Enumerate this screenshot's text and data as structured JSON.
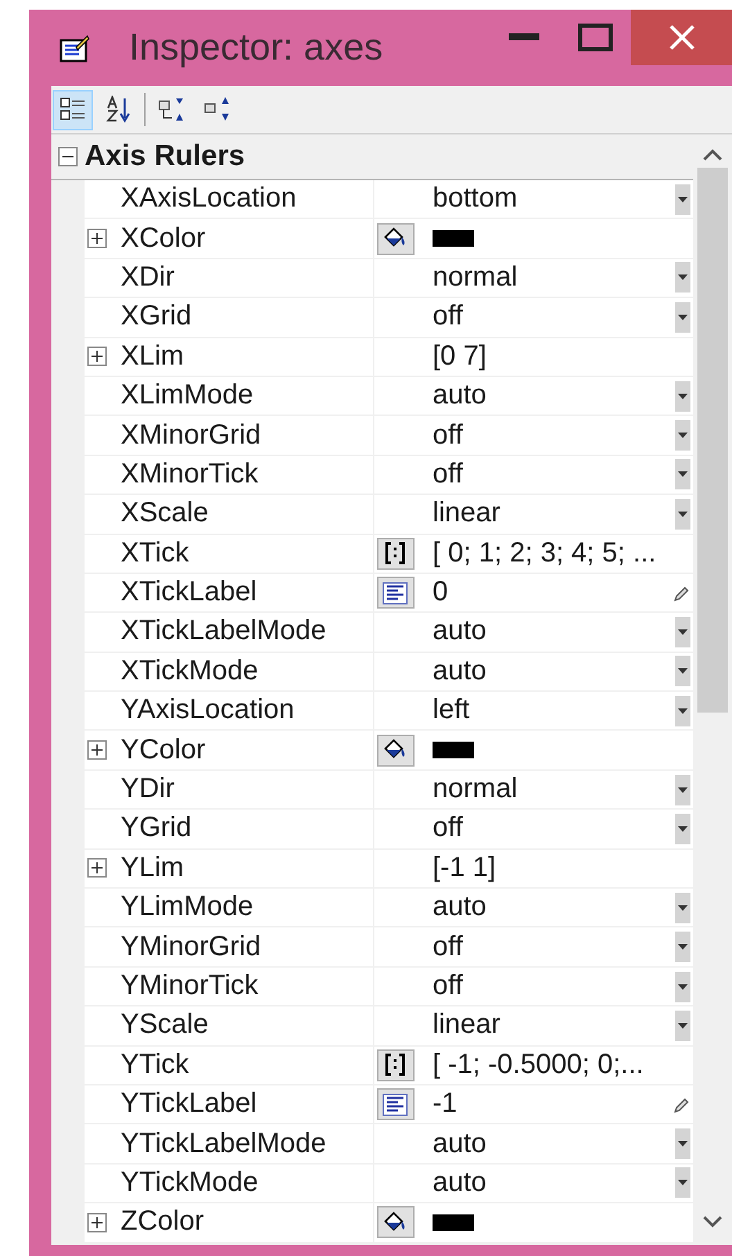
{
  "window": {
    "title": "Inspector:  axes"
  },
  "toolbar": [
    {
      "selected": true
    },
    {
      "selected": false
    },
    {
      "selected": false
    },
    {
      "selected": false
    }
  ],
  "category": {
    "label": "Axis Rulers",
    "expanded": true
  },
  "properties": [
    {
      "name": "XAxisLocation",
      "value": "bottom",
      "kind": "dropdown"
    },
    {
      "name": "XColor",
      "kind": "color",
      "expanded": false,
      "color": "#000000"
    },
    {
      "name": "XDir",
      "value": "normal",
      "kind": "dropdown"
    },
    {
      "name": "XGrid",
      "value": "off",
      "kind": "dropdown"
    },
    {
      "name": "XLim",
      "value": "[0 7]",
      "kind": "text",
      "expanded": false
    },
    {
      "name": "XLimMode",
      "value": "auto",
      "kind": "dropdown"
    },
    {
      "name": "XMinorGrid",
      "value": "off",
      "kind": "dropdown"
    },
    {
      "name": "XMinorTick",
      "value": "off",
      "kind": "dropdown"
    },
    {
      "name": "XScale",
      "value": "linear",
      "kind": "dropdown"
    },
    {
      "name": "XTick",
      "value": "[ 0; 1; 2; 3; 4; 5; ...",
      "kind": "array"
    },
    {
      "name": "XTickLabel",
      "value": "0",
      "kind": "string"
    },
    {
      "name": "XTickLabelMode",
      "value": "auto",
      "kind": "dropdown"
    },
    {
      "name": "XTickMode",
      "value": "auto",
      "kind": "dropdown"
    },
    {
      "name": "YAxisLocation",
      "value": "left",
      "kind": "dropdown"
    },
    {
      "name": "YColor",
      "kind": "color",
      "expanded": false,
      "color": "#000000"
    },
    {
      "name": "YDir",
      "value": "normal",
      "kind": "dropdown"
    },
    {
      "name": "YGrid",
      "value": "off",
      "kind": "dropdown"
    },
    {
      "name": "YLim",
      "value": "[-1 1]",
      "kind": "text",
      "expanded": false
    },
    {
      "name": "YLimMode",
      "value": "auto",
      "kind": "dropdown"
    },
    {
      "name": "YMinorGrid",
      "value": "off",
      "kind": "dropdown"
    },
    {
      "name": "YMinorTick",
      "value": "off",
      "kind": "dropdown"
    },
    {
      "name": "YScale",
      "value": "linear",
      "kind": "dropdown"
    },
    {
      "name": "YTick",
      "value": "[ -1; -0.5000; 0;...",
      "kind": "array"
    },
    {
      "name": "YTickLabel",
      "value": "-1",
      "kind": "string"
    },
    {
      "name": "YTickLabelMode",
      "value": "auto",
      "kind": "dropdown"
    },
    {
      "name": "YTickMode",
      "value": "auto",
      "kind": "dropdown"
    },
    {
      "name": "ZColor",
      "kind": "color",
      "expanded": false,
      "color": "#000000"
    }
  ]
}
